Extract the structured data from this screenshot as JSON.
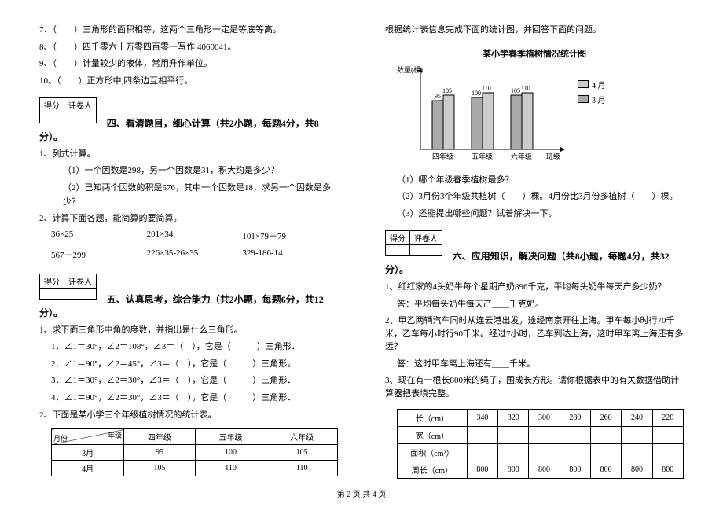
{
  "col1": {
    "judgments": {
      "j7": "7、（　　）三角形的面积相等，这两个三角形一定是等底等高。",
      "j8": "8、（　　）四千零六十万零四百零一写作:4060041。",
      "j9": "9、（　　）计量较少的液体，常用升作单位。",
      "j10": "10、（　　）正方形中,四条边互相平行。"
    },
    "score_header": {
      "score": "得分",
      "marker": "评卷人"
    },
    "section4": {
      "title": "四、看清题目，细心计算（共2小题，每题4分，共8分）。",
      "q1": "1、列式计算。",
      "q1_1": "（1）一个因数是298，另一个因数是31，积大约是多少？",
      "q1_2": "（2）已知两个因数的积是576，其中一个因数是18，求另一个因数是多少？",
      "q2": "2、计算下面各题，能简算的要简算。",
      "calc1": {
        "a": "36×25",
        "b": "201×34",
        "c": "101×79－79"
      },
      "calc2": {
        "a": "567－299",
        "b": "226×35-26×35",
        "c": "329-186-14"
      }
    },
    "section5": {
      "title": "五、认真思考，综合能力（共2小题，每题6分，共12分）。",
      "q1": "1、求下面三角形中角的度数，并指出是什么三角形。",
      "q1_1": "1．∠1＝30°，∠2＝108°，∠3＝（　），它是（　　　）三角形．",
      "q1_2": "2．∠1＝90°，∠2＝45°，∠3＝（　），它是（　　　）三角形。",
      "q1_3": "3．∠1＝30°，∠2＝30°，∠3＝（　），它是（　　　）三角形．",
      "q1_4": "4．∠1＝90°，∠2＝30°，∠3＝（　），它是（　　　）三角形．",
      "q2": "2、下面是某小学三个年级植树情况的统计表。",
      "table": {
        "diag_top": "年级",
        "diag_bot": "月份",
        "cols": [
          "四年级",
          "五年级",
          "六年级"
        ],
        "rows": [
          {
            "label": "3月",
            "vals": [
              "95",
              "100",
              "105"
            ]
          },
          {
            "label": "4月",
            "vals": [
              "105",
              "110",
              "110"
            ]
          }
        ]
      }
    }
  },
  "col2": {
    "continue": "根据统计表信息完成下面的统计图，并回答下面的问题。",
    "chart_title": "某小学春季植树情况统计图",
    "chart_ylabel": "数量(棵)",
    "chart_xlabel": "班级",
    "legend": {
      "s1": "4 月",
      "s2": "3 月"
    },
    "chart_data": {
      "type": "bar",
      "categories": [
        "四年级",
        "五年级",
        "六年级"
      ],
      "series": [
        {
          "name": "3月",
          "values": [
            95,
            100,
            105
          ]
        },
        {
          "name": "4月",
          "values": [
            105,
            110,
            110
          ]
        }
      ],
      "ylabel": "数量(棵)",
      "xlabel": "班级",
      "ylim": [
        0,
        120
      ]
    },
    "chart_q1": "（1）哪个年级春季植树最多？",
    "chart_q2": "（2）3月份3个年级共植树（　　）棵。4月份比3月份多植树（　　）棵。",
    "chart_q3": "（3）还能提出哪些问题？试着解决一下。",
    "section6": {
      "title": "六、应用知识，解决问题（共8小题，每题4分，共32分）。",
      "q1": "1、红红家的4头奶牛每个星期产奶896千克，平均每头奶牛每天产多少奶？",
      "q1_ans": "答：平均每头奶牛每天产____千克奶。",
      "q2": "2、甲乙两辆汽车同时从连云港出发，途经南京开往上海。甲车每小时行70千米，乙车每小时行90千米。经过7小时，乙车到达上海，这时甲车离上海还有多远？",
      "q2_ans": "答：这时甲车离上海还有____千米。",
      "q3": "3、现在有一根长800米的绳子，围成长方形。请你根据表中的有关数据借助计算器把表填完整。",
      "table": {
        "rows": [
          {
            "label": "长（cm）",
            "vals": [
              "340",
              "320",
              "300",
              "280",
              "260",
              "240",
              "220"
            ]
          },
          {
            "label": "宽（cm）",
            "vals": [
              "",
              "",
              "",
              "",
              "",
              "",
              ""
            ]
          },
          {
            "label": "面积（cm²）",
            "vals": [
              "",
              "",
              "",
              "",
              "",
              "",
              ""
            ]
          },
          {
            "label": "周长（cm）",
            "vals": [
              "800",
              "800",
              "800",
              "800",
              "800",
              "800",
              "800"
            ]
          }
        ]
      }
    }
  },
  "footer": "第 2 页 共 4 页"
}
